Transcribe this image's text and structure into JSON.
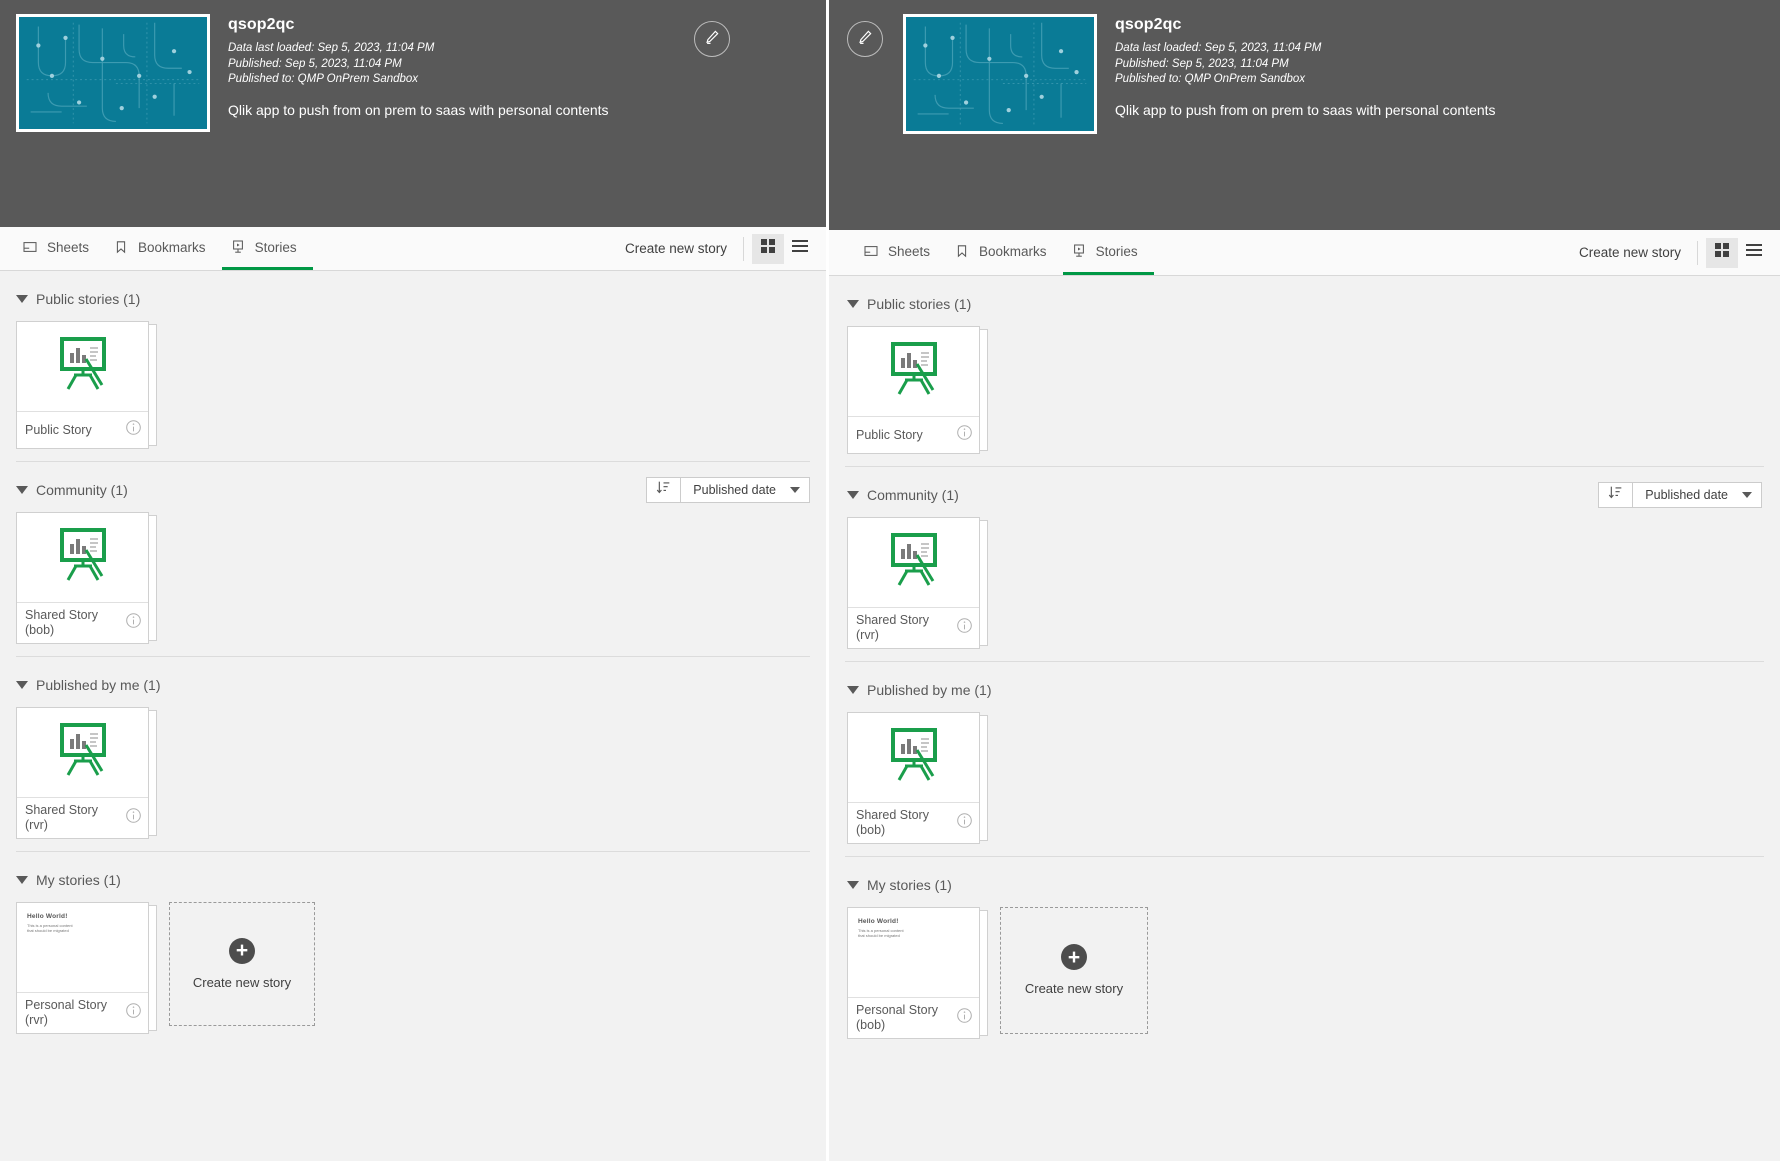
{
  "app": {
    "title": "qsop2qc",
    "data_last_loaded": "Data last loaded: Sep 5, 2023, 11:04 PM",
    "published": "Published: Sep 5, 2023, 11:04 PM",
    "published_to": "Published to: QMP OnPrem Sandbox",
    "description": "Qlik app to push from on prem to saas with personal contents",
    "edit_icon": "pencil-icon",
    "thumb_color": "#0a7b96"
  },
  "tabs": [
    {
      "label": "Sheets",
      "icon": "sheet-icon",
      "active": false
    },
    {
      "label": "Bookmarks",
      "icon": "bookmark-icon",
      "active": false
    },
    {
      "label": "Stories",
      "icon": "story-icon",
      "active": true
    }
  ],
  "toolbar": {
    "create_new_story": "Create new story",
    "grid_view_icon": "grid-view-icon",
    "list_view_icon": "list-view-icon",
    "active_view": "grid"
  },
  "sort": {
    "direction_icon": "sort-descending-icon",
    "selected": "Published date",
    "chevron_icon": "chevron-down-icon"
  },
  "accent_color": "#009845",
  "left_panel": {
    "sections": [
      {
        "title": "Public stories (1)",
        "has_sort": false,
        "cards": [
          {
            "label": "Public Story",
            "thumb": "story-easel-icon"
          }
        ],
        "create_tile": false
      },
      {
        "title": "Community (1)",
        "has_sort": true,
        "cards": [
          {
            "label": "Shared Story (bob)",
            "thumb": "story-easel-icon"
          }
        ],
        "create_tile": false
      },
      {
        "title": "Published by me (1)",
        "has_sort": false,
        "cards": [
          {
            "label": "Shared Story (rvr)",
            "thumb": "story-easel-icon"
          }
        ],
        "create_tile": false
      },
      {
        "title": "My stories (1)",
        "has_sort": false,
        "cards": [
          {
            "label": "Personal Story (rvr)",
            "thumb": "hello-world-slide"
          }
        ],
        "create_tile": true
      }
    ]
  },
  "right_panel": {
    "sections": [
      {
        "title": "Public stories (1)",
        "has_sort": false,
        "cards": [
          {
            "label": "Public Story",
            "thumb": "story-easel-icon"
          }
        ],
        "create_tile": false
      },
      {
        "title": "Community (1)",
        "has_sort": true,
        "cards": [
          {
            "label": "Shared Story (rvr)",
            "thumb": "story-easel-icon"
          }
        ],
        "create_tile": false
      },
      {
        "title": "Published by me (1)",
        "has_sort": false,
        "cards": [
          {
            "label": "Shared Story (bob)",
            "thumb": "story-easel-icon"
          }
        ],
        "create_tile": false
      },
      {
        "title": "My stories (1)",
        "has_sort": false,
        "cards": [
          {
            "label": "Personal Story (bob)",
            "thumb": "hello-world-slide"
          }
        ],
        "create_tile": true
      }
    ]
  },
  "slide_thumb": {
    "title": "Hello World!",
    "line1": "This is a personal content",
    "line2": "that should be migrated"
  },
  "create_tile": {
    "label": "Create new story",
    "icon": "plus-circle-icon"
  }
}
